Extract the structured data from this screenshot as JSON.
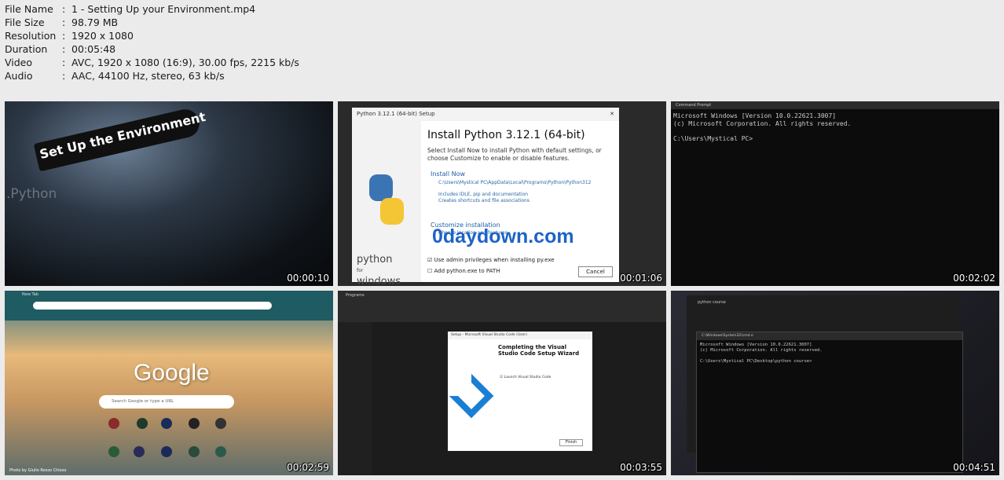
{
  "info": [
    {
      "key": "File Name",
      "value": "1 - Setting Up your Environment.mp4"
    },
    {
      "key": "File Size",
      "value": "98.79 MB"
    },
    {
      "key": "Resolution",
      "value": "1920 x 1080"
    },
    {
      "key": "Duration",
      "value": "00:05:48"
    },
    {
      "key": "Video",
      "value": "AVC, 1920 x 1080 (16:9), 30.00 fps, 2215 kb/s"
    },
    {
      "key": "Audio",
      "value": "AAC, 44100 Hz, stereo, 63 kb/s"
    }
  ],
  "separator": ":",
  "thumbs": [
    {
      "timestamp": "00:00:10",
      "banner": "Set Up the Environment",
      "subtitle": ".Python"
    },
    {
      "timestamp": "00:01:06",
      "window_title": "Python 3.12.1 (64-bit) Setup",
      "heading": "Install Python 3.12.1 (64-bit)",
      "description": "Select Install Now to install Python with default settings, or choose Customize to enable or disable features.",
      "install_now": "Install Now",
      "install_path": "C:\\Users\\Mystical PC\\AppData\\Local\\Programs\\Python\\Python312",
      "includes": "Includes IDLE, pip and documentation",
      "shortcuts": "Creates shortcuts and file associations",
      "customize": "Customize installation",
      "customize_sub": "Choose location and features",
      "admin_checkbox": "Use admin privileges when installing py.exe",
      "path_checkbox": "Add python.exe to PATH",
      "cancel": "Cancel",
      "python_word": "python",
      "for_word": "for",
      "windows_word": "windows",
      "watermark": "0daydown.com"
    },
    {
      "timestamp": "00:02:02",
      "tab_title": "Command Prompt",
      "lines": [
        "Microsoft Windows [Version 10.0.22621.3007]",
        "(c) Microsoft Corporation. All rights reserved.",
        "",
        "C:\\Users\\Mystical PC>"
      ]
    },
    {
      "timestamp": "00:02:59",
      "tab_title": "New Tab",
      "logo": "Google",
      "search_placeholder": "Search Google or type a URL",
      "photo_credit": "Photo by Giulio Rosso Chioso"
    },
    {
      "timestamp": "00:03:55",
      "window_title": "Setup - Microsoft Visual Studio Code (User)",
      "heading": "Completing the Visual Studio Code Setup Wizard",
      "checkbox": "Launch Visual Studio Code",
      "finish": "Finish",
      "folder": "Programs"
    },
    {
      "timestamp": "00:04:51",
      "folder": "python course",
      "term_title": "C:\\Windows\\System32\\cmd.e",
      "lines": [
        "Microsoft Windows [Version 10.0.22621.3007]",
        "(c) Microsoft Corporation. All rights reserved.",
        "",
        "C:\\Users\\Mystical PC\\Desktop\\python course>"
      ]
    }
  ]
}
